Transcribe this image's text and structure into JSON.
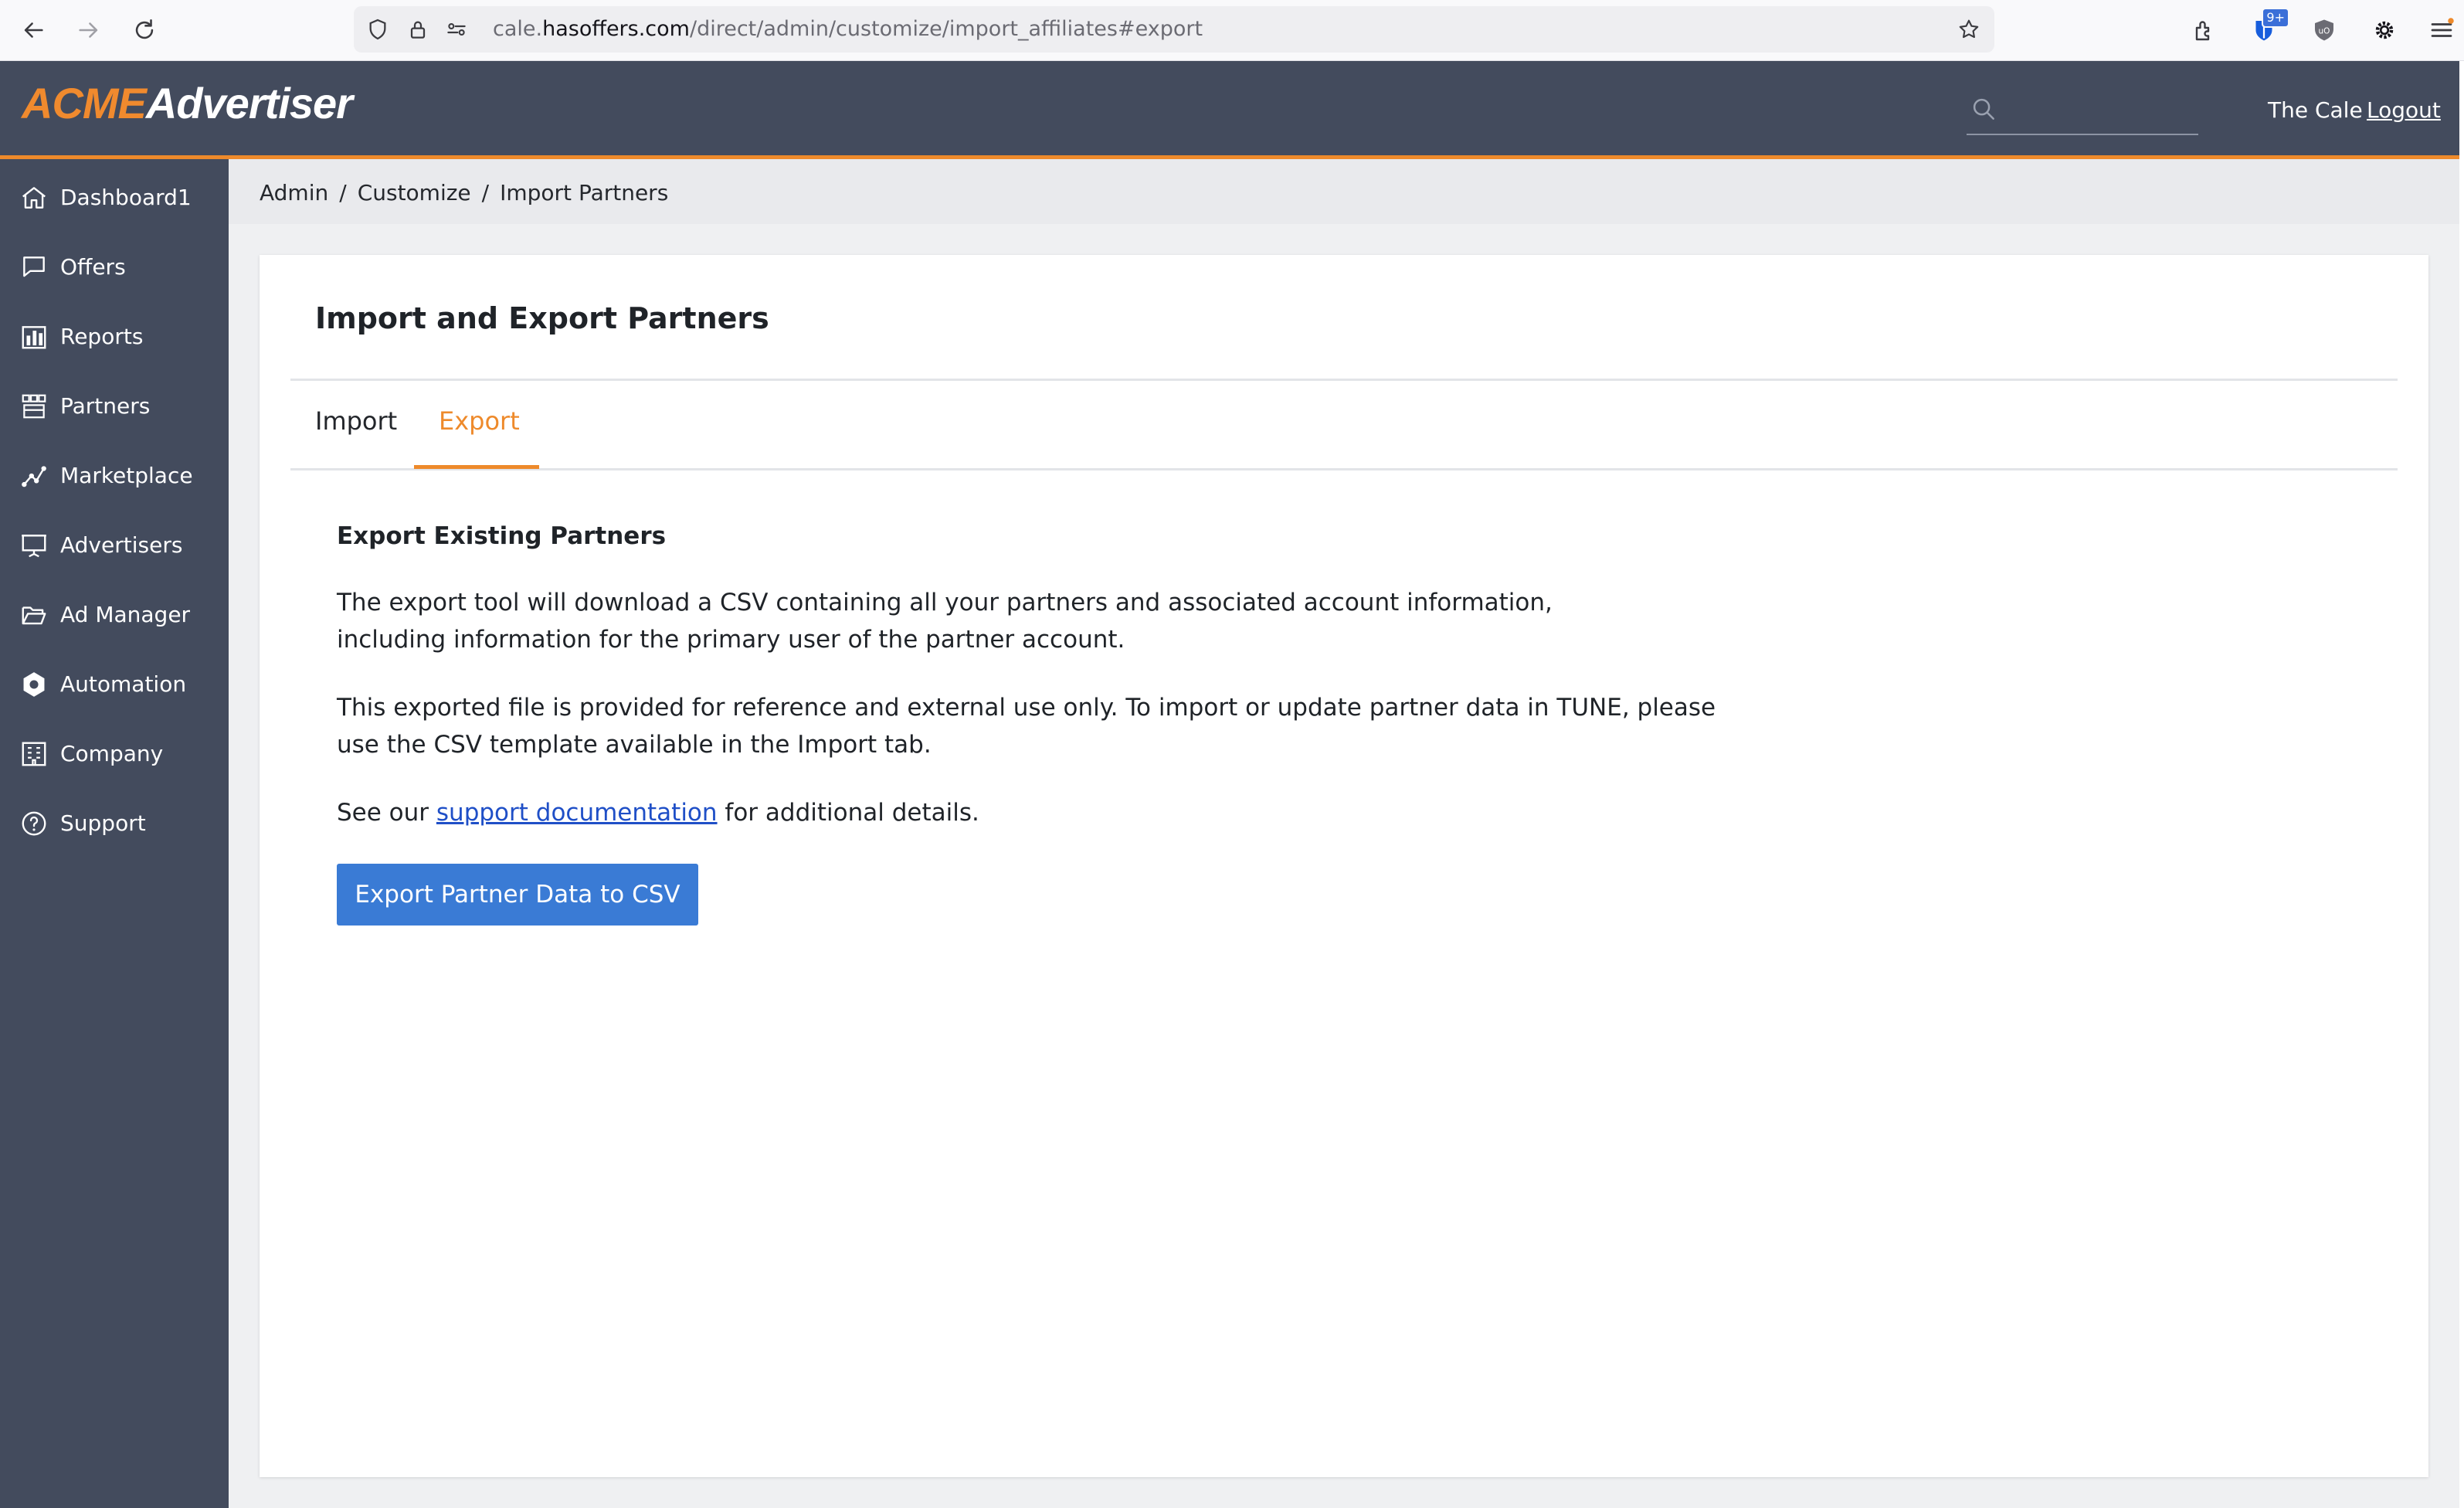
{
  "browser": {
    "url_scheme_host_prefix": "cale.",
    "url_host": "hasoffers.com",
    "url_path": "/direct/admin/customize/import_affiliates#export",
    "extension_badge": "9+"
  },
  "header": {
    "logo_primary": "ACME",
    "logo_secondary": "Advertiser",
    "search_placeholder": "",
    "user_name": "The Cale",
    "logout_label": "Logout",
    "bar_color": "#434b5d",
    "accent_color": "#ee8a2b"
  },
  "sidebar": {
    "items": [
      {
        "label": "Dashboard1",
        "icon": "home-icon"
      },
      {
        "label": "Offers",
        "icon": "chat-bubble-icon"
      },
      {
        "label": "Reports",
        "icon": "bar-chart-icon"
      },
      {
        "label": "Partners",
        "icon": "partners-grid-icon"
      },
      {
        "label": "Marketplace",
        "icon": "network-nodes-icon"
      },
      {
        "label": "Advertisers",
        "icon": "presentation-board-icon"
      },
      {
        "label": "Ad Manager",
        "icon": "folder-open-icon"
      },
      {
        "label": "Automation",
        "icon": "hexagon-gear-icon"
      },
      {
        "label": "Company",
        "icon": "building-icon"
      },
      {
        "label": "Support",
        "icon": "help-circle-icon"
      }
    ]
  },
  "breadcrumb": {
    "items": [
      "Admin",
      "Customize",
      "Import Partners"
    ],
    "separator": "/"
  },
  "panel": {
    "title": "Import and Export Partners",
    "tabs": [
      {
        "label": "Import",
        "active": false
      },
      {
        "label": "Export",
        "active": true
      }
    ],
    "section_heading": "Export Existing Partners",
    "paragraph_1": "The export tool will download a CSV containing all your partners and associated account information, including information for the primary user of the partner account.",
    "paragraph_2": "This exported file is provided for reference and external use only. To import or update partner data in TUNE, please use the CSV template available in the Import tab.",
    "paragraph_3_prefix": "See our ",
    "paragraph_3_link": "support documentation",
    "paragraph_3_suffix": " for additional details.",
    "export_button_label": "Export Partner Data to CSV",
    "button_color": "#3a7bd5"
  }
}
